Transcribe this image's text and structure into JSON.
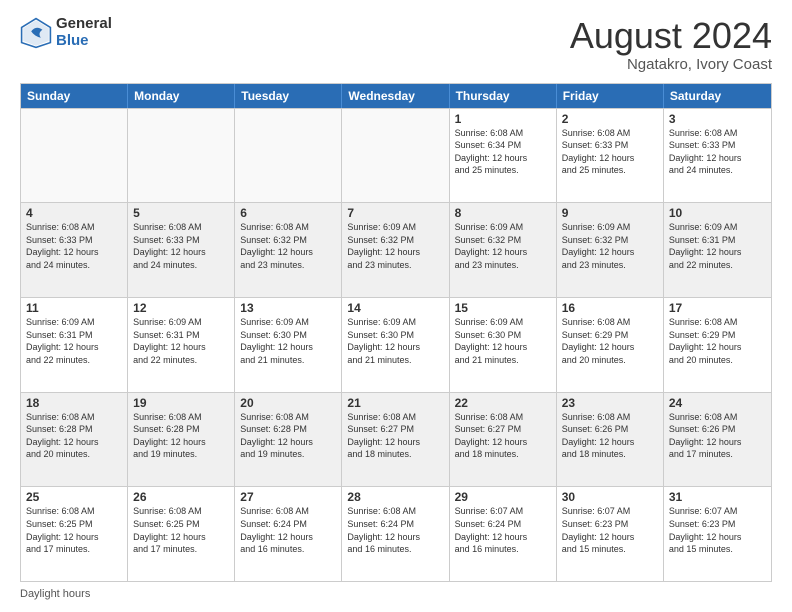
{
  "logo": {
    "general": "General",
    "blue": "Blue"
  },
  "title": "August 2024",
  "subtitle": "Ngatakro, Ivory Coast",
  "days": [
    "Sunday",
    "Monday",
    "Tuesday",
    "Wednesday",
    "Thursday",
    "Friday",
    "Saturday"
  ],
  "footer": "Daylight hours",
  "weeks": [
    [
      {
        "day": "",
        "info": ""
      },
      {
        "day": "",
        "info": ""
      },
      {
        "day": "",
        "info": ""
      },
      {
        "day": "",
        "info": ""
      },
      {
        "day": "1",
        "info": "Sunrise: 6:08 AM\nSunset: 6:34 PM\nDaylight: 12 hours\nand 25 minutes."
      },
      {
        "day": "2",
        "info": "Sunrise: 6:08 AM\nSunset: 6:33 PM\nDaylight: 12 hours\nand 25 minutes."
      },
      {
        "day": "3",
        "info": "Sunrise: 6:08 AM\nSunset: 6:33 PM\nDaylight: 12 hours\nand 24 minutes."
      }
    ],
    [
      {
        "day": "4",
        "info": "Sunrise: 6:08 AM\nSunset: 6:33 PM\nDaylight: 12 hours\nand 24 minutes."
      },
      {
        "day": "5",
        "info": "Sunrise: 6:08 AM\nSunset: 6:33 PM\nDaylight: 12 hours\nand 24 minutes."
      },
      {
        "day": "6",
        "info": "Sunrise: 6:08 AM\nSunset: 6:32 PM\nDaylight: 12 hours\nand 23 minutes."
      },
      {
        "day": "7",
        "info": "Sunrise: 6:09 AM\nSunset: 6:32 PM\nDaylight: 12 hours\nand 23 minutes."
      },
      {
        "day": "8",
        "info": "Sunrise: 6:09 AM\nSunset: 6:32 PM\nDaylight: 12 hours\nand 23 minutes."
      },
      {
        "day": "9",
        "info": "Sunrise: 6:09 AM\nSunset: 6:32 PM\nDaylight: 12 hours\nand 23 minutes."
      },
      {
        "day": "10",
        "info": "Sunrise: 6:09 AM\nSunset: 6:31 PM\nDaylight: 12 hours\nand 22 minutes."
      }
    ],
    [
      {
        "day": "11",
        "info": "Sunrise: 6:09 AM\nSunset: 6:31 PM\nDaylight: 12 hours\nand 22 minutes."
      },
      {
        "day": "12",
        "info": "Sunrise: 6:09 AM\nSunset: 6:31 PM\nDaylight: 12 hours\nand 22 minutes."
      },
      {
        "day": "13",
        "info": "Sunrise: 6:09 AM\nSunset: 6:30 PM\nDaylight: 12 hours\nand 21 minutes."
      },
      {
        "day": "14",
        "info": "Sunrise: 6:09 AM\nSunset: 6:30 PM\nDaylight: 12 hours\nand 21 minutes."
      },
      {
        "day": "15",
        "info": "Sunrise: 6:09 AM\nSunset: 6:30 PM\nDaylight: 12 hours\nand 21 minutes."
      },
      {
        "day": "16",
        "info": "Sunrise: 6:08 AM\nSunset: 6:29 PM\nDaylight: 12 hours\nand 20 minutes."
      },
      {
        "day": "17",
        "info": "Sunrise: 6:08 AM\nSunset: 6:29 PM\nDaylight: 12 hours\nand 20 minutes."
      }
    ],
    [
      {
        "day": "18",
        "info": "Sunrise: 6:08 AM\nSunset: 6:28 PM\nDaylight: 12 hours\nand 20 minutes."
      },
      {
        "day": "19",
        "info": "Sunrise: 6:08 AM\nSunset: 6:28 PM\nDaylight: 12 hours\nand 19 minutes."
      },
      {
        "day": "20",
        "info": "Sunrise: 6:08 AM\nSunset: 6:28 PM\nDaylight: 12 hours\nand 19 minutes."
      },
      {
        "day": "21",
        "info": "Sunrise: 6:08 AM\nSunset: 6:27 PM\nDaylight: 12 hours\nand 18 minutes."
      },
      {
        "day": "22",
        "info": "Sunrise: 6:08 AM\nSunset: 6:27 PM\nDaylight: 12 hours\nand 18 minutes."
      },
      {
        "day": "23",
        "info": "Sunrise: 6:08 AM\nSunset: 6:26 PM\nDaylight: 12 hours\nand 18 minutes."
      },
      {
        "day": "24",
        "info": "Sunrise: 6:08 AM\nSunset: 6:26 PM\nDaylight: 12 hours\nand 17 minutes."
      }
    ],
    [
      {
        "day": "25",
        "info": "Sunrise: 6:08 AM\nSunset: 6:25 PM\nDaylight: 12 hours\nand 17 minutes."
      },
      {
        "day": "26",
        "info": "Sunrise: 6:08 AM\nSunset: 6:25 PM\nDaylight: 12 hours\nand 17 minutes."
      },
      {
        "day": "27",
        "info": "Sunrise: 6:08 AM\nSunset: 6:24 PM\nDaylight: 12 hours\nand 16 minutes."
      },
      {
        "day": "28",
        "info": "Sunrise: 6:08 AM\nSunset: 6:24 PM\nDaylight: 12 hours\nand 16 minutes."
      },
      {
        "day": "29",
        "info": "Sunrise: 6:07 AM\nSunset: 6:24 PM\nDaylight: 12 hours\nand 16 minutes."
      },
      {
        "day": "30",
        "info": "Sunrise: 6:07 AM\nSunset: 6:23 PM\nDaylight: 12 hours\nand 15 minutes."
      },
      {
        "day": "31",
        "info": "Sunrise: 6:07 AM\nSunset: 6:23 PM\nDaylight: 12 hours\nand 15 minutes."
      }
    ]
  ]
}
